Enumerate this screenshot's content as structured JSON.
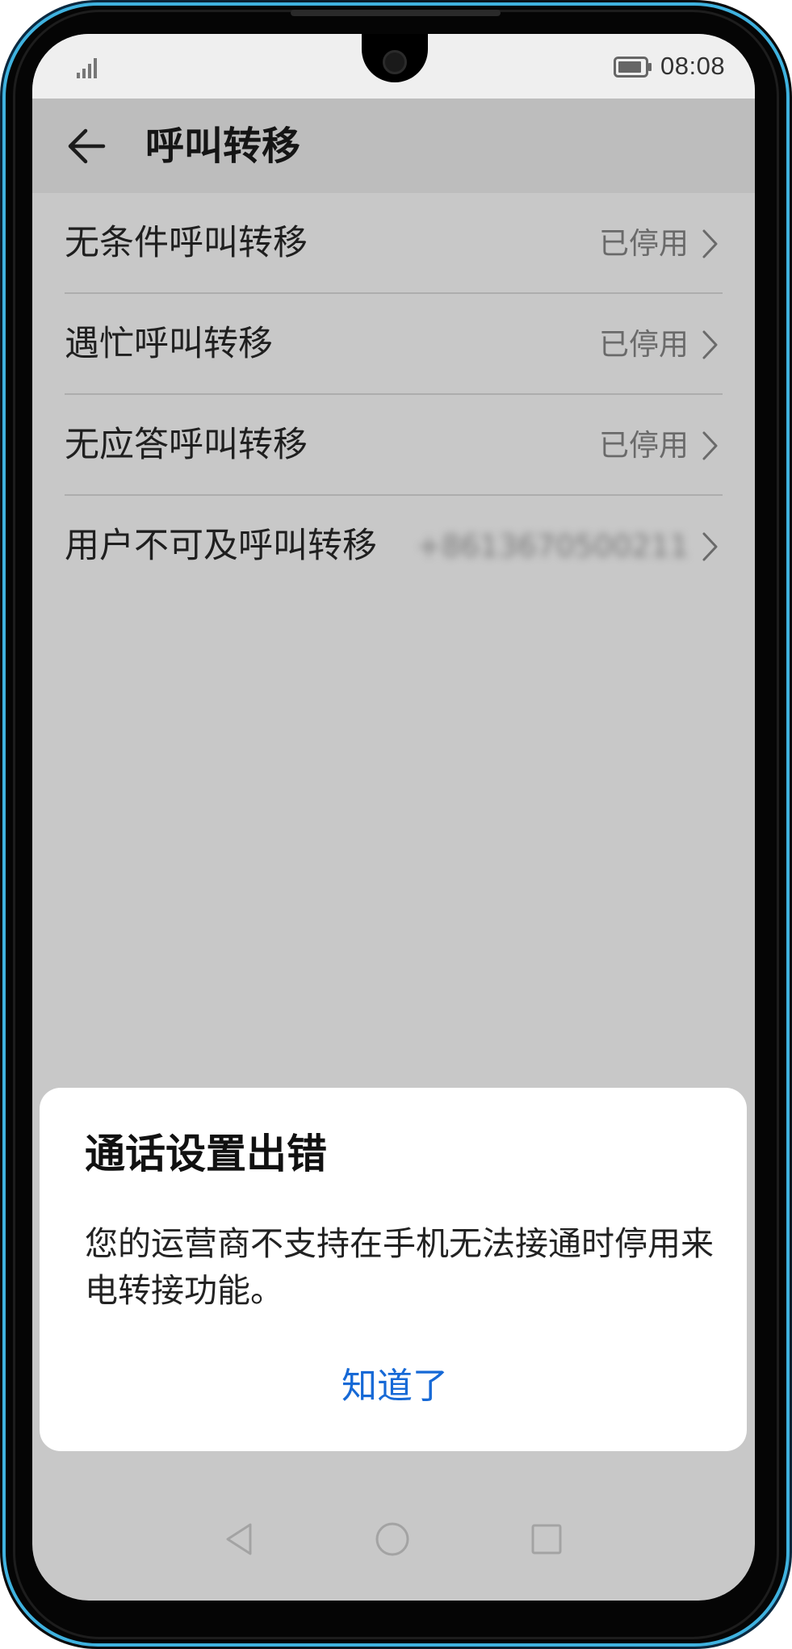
{
  "status_bar": {
    "time": "08:08",
    "signal_icon": "signal-icon",
    "battery_icon": "battery-icon"
  },
  "header": {
    "back_icon": "back-arrow-icon",
    "title": "呼叫转移"
  },
  "settings": {
    "items": [
      {
        "label": "无条件呼叫转移",
        "value": "已停用"
      },
      {
        "label": "遇忙呼叫转移",
        "value": "已停用"
      },
      {
        "label": "无应答呼叫转移",
        "value": "已停用"
      },
      {
        "label": "用户不可及呼叫转移",
        "value": "+8613670500211"
      }
    ]
  },
  "dialog": {
    "title": "通话设置出错",
    "message": "您的运营商不支持在手机无法接通时停用来电转接功能。",
    "button_label": "知道了"
  },
  "nav_bar": {
    "back_icon": "nav-back-icon",
    "home_icon": "nav-home-icon",
    "recent_icon": "nav-recent-icon"
  },
  "colors": {
    "accent": "#1669d6",
    "scrim": "#c8c8c8",
    "header_bg": "#bdbdbd",
    "dialog_bg": "#ffffff",
    "frame_highlight": "#3fb2df"
  }
}
